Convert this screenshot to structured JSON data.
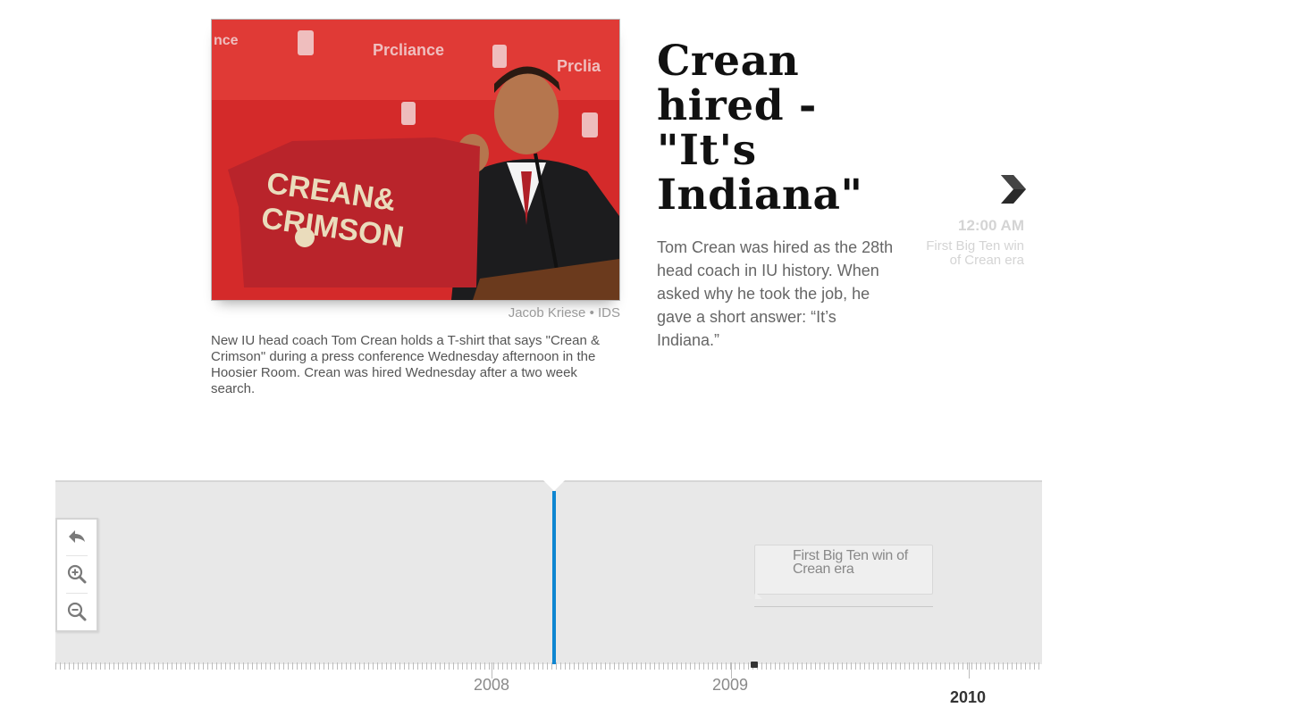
{
  "slide": {
    "photo_credit": "Jacob Kriese • IDS",
    "photo_caption": "New IU head coach Tom Crean holds a T-shirt that says \"Crean & Crimson\" during a press conference Wednesday afternoon in the Hoosier Room. Crean was hired Wednesday after a two week search.",
    "photo_shirt_text_line1": "CREAN&",
    "photo_shirt_text_line2": "CRIMSON",
    "headline": "Crean hired - \"It's Indiana\"",
    "body": "Tom Crean was hired as the 28th head coach in IU history. When asked why he took the job, he gave a short answer: “It’s Indiana.”"
  },
  "next_slide": {
    "icon": "chevron-right-icon",
    "time": "12:00 AM",
    "title": "First Big Ten win of Crean era"
  },
  "timeline": {
    "nav": {
      "back_icon": "back-arrow-icon",
      "zoom_in_icon": "zoom-in-icon",
      "zoom_out_icon": "zoom-out-icon"
    },
    "event_card_title": "First Big Ten win of Crean era",
    "years": [
      "2008",
      "2009",
      "2010"
    ],
    "marker_color": "#0e86d1"
  }
}
